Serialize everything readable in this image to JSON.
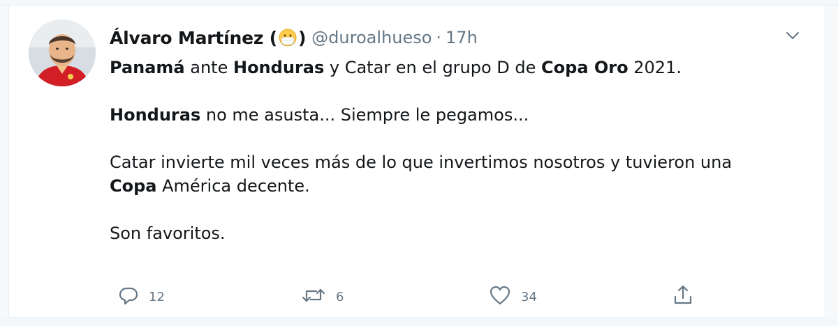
{
  "tweet": {
    "author": {
      "name": "Álvaro Martínez (",
      "name_close": ")",
      "emoji": "mask-face-emoji",
      "handle": "@duroalhueso",
      "separator": "·",
      "time": "17h"
    },
    "body": {
      "line1": [
        {
          "text": "Panamá",
          "bold": true
        },
        {
          "text": " ante ",
          "bold": false
        },
        {
          "text": "Honduras",
          "bold": true
        },
        {
          "text": " y Catar en el grupo D de ",
          "bold": false
        },
        {
          "text": "Copa Oro",
          "bold": true
        },
        {
          "text": " 2021.",
          "bold": false
        }
      ],
      "line2": [
        {
          "text": "Honduras",
          "bold": true
        },
        {
          "text": " no me asusta... Siempre le pegamos...",
          "bold": false
        }
      ],
      "line3": [
        {
          "text": "Catar invierte mil veces más de lo que invertimos nosotros y tuvieron una",
          "bold": false
        }
      ],
      "line4": [
        {
          "text": "Copa",
          "bold": true
        },
        {
          "text": " América decente.",
          "bold": false
        }
      ],
      "line5": [
        {
          "text": "Son favoritos.",
          "bold": false
        }
      ]
    },
    "actions": {
      "reply": {
        "icon": "reply-icon",
        "count": "12"
      },
      "retweet": {
        "icon": "retweet-icon",
        "count": "6"
      },
      "like": {
        "icon": "heart-icon",
        "count": "34"
      },
      "share": {
        "icon": "share-icon"
      }
    },
    "menu_icon": "chevron-down-icon"
  },
  "colors": {
    "text": "#14171a",
    "secondary": "#657786",
    "border": "#e6ecf0",
    "background": "#ffffff"
  }
}
